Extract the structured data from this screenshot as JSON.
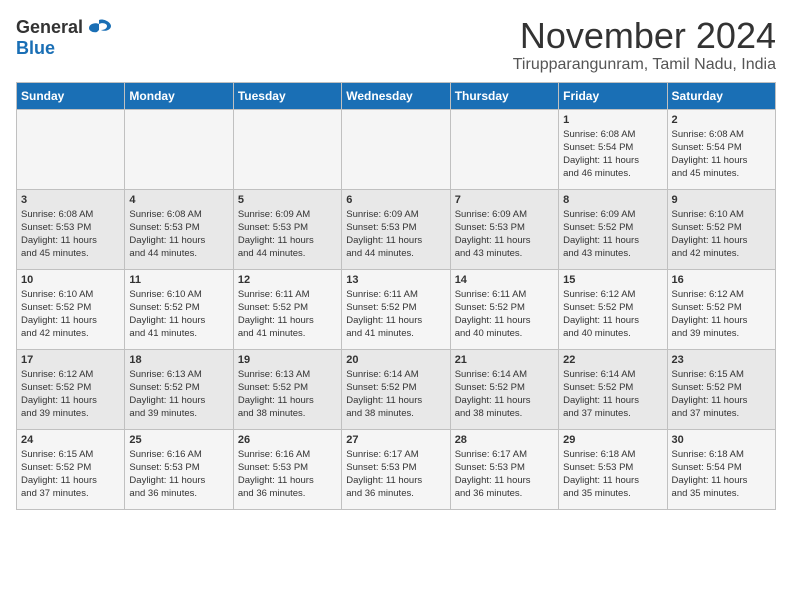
{
  "header": {
    "logo_general": "General",
    "logo_blue": "Blue",
    "title": "November 2024",
    "subtitle": "Tirupparangunram, Tamil Nadu, India"
  },
  "calendar": {
    "days_of_week": [
      "Sunday",
      "Monday",
      "Tuesday",
      "Wednesday",
      "Thursday",
      "Friday",
      "Saturday"
    ],
    "weeks": [
      [
        {
          "day": "",
          "info": ""
        },
        {
          "day": "",
          "info": ""
        },
        {
          "day": "",
          "info": ""
        },
        {
          "day": "",
          "info": ""
        },
        {
          "day": "",
          "info": ""
        },
        {
          "day": "1",
          "info": "Sunrise: 6:08 AM\nSunset: 5:54 PM\nDaylight: 11 hours\nand 46 minutes."
        },
        {
          "day": "2",
          "info": "Sunrise: 6:08 AM\nSunset: 5:54 PM\nDaylight: 11 hours\nand 45 minutes."
        }
      ],
      [
        {
          "day": "3",
          "info": "Sunrise: 6:08 AM\nSunset: 5:53 PM\nDaylight: 11 hours\nand 45 minutes."
        },
        {
          "day": "4",
          "info": "Sunrise: 6:08 AM\nSunset: 5:53 PM\nDaylight: 11 hours\nand 44 minutes."
        },
        {
          "day": "5",
          "info": "Sunrise: 6:09 AM\nSunset: 5:53 PM\nDaylight: 11 hours\nand 44 minutes."
        },
        {
          "day": "6",
          "info": "Sunrise: 6:09 AM\nSunset: 5:53 PM\nDaylight: 11 hours\nand 44 minutes."
        },
        {
          "day": "7",
          "info": "Sunrise: 6:09 AM\nSunset: 5:53 PM\nDaylight: 11 hours\nand 43 minutes."
        },
        {
          "day": "8",
          "info": "Sunrise: 6:09 AM\nSunset: 5:52 PM\nDaylight: 11 hours\nand 43 minutes."
        },
        {
          "day": "9",
          "info": "Sunrise: 6:10 AM\nSunset: 5:52 PM\nDaylight: 11 hours\nand 42 minutes."
        }
      ],
      [
        {
          "day": "10",
          "info": "Sunrise: 6:10 AM\nSunset: 5:52 PM\nDaylight: 11 hours\nand 42 minutes."
        },
        {
          "day": "11",
          "info": "Sunrise: 6:10 AM\nSunset: 5:52 PM\nDaylight: 11 hours\nand 41 minutes."
        },
        {
          "day": "12",
          "info": "Sunrise: 6:11 AM\nSunset: 5:52 PM\nDaylight: 11 hours\nand 41 minutes."
        },
        {
          "day": "13",
          "info": "Sunrise: 6:11 AM\nSunset: 5:52 PM\nDaylight: 11 hours\nand 41 minutes."
        },
        {
          "day": "14",
          "info": "Sunrise: 6:11 AM\nSunset: 5:52 PM\nDaylight: 11 hours\nand 40 minutes."
        },
        {
          "day": "15",
          "info": "Sunrise: 6:12 AM\nSunset: 5:52 PM\nDaylight: 11 hours\nand 40 minutes."
        },
        {
          "day": "16",
          "info": "Sunrise: 6:12 AM\nSunset: 5:52 PM\nDaylight: 11 hours\nand 39 minutes."
        }
      ],
      [
        {
          "day": "17",
          "info": "Sunrise: 6:12 AM\nSunset: 5:52 PM\nDaylight: 11 hours\nand 39 minutes."
        },
        {
          "day": "18",
          "info": "Sunrise: 6:13 AM\nSunset: 5:52 PM\nDaylight: 11 hours\nand 39 minutes."
        },
        {
          "day": "19",
          "info": "Sunrise: 6:13 AM\nSunset: 5:52 PM\nDaylight: 11 hours\nand 38 minutes."
        },
        {
          "day": "20",
          "info": "Sunrise: 6:14 AM\nSunset: 5:52 PM\nDaylight: 11 hours\nand 38 minutes."
        },
        {
          "day": "21",
          "info": "Sunrise: 6:14 AM\nSunset: 5:52 PM\nDaylight: 11 hours\nand 38 minutes."
        },
        {
          "day": "22",
          "info": "Sunrise: 6:14 AM\nSunset: 5:52 PM\nDaylight: 11 hours\nand 37 minutes."
        },
        {
          "day": "23",
          "info": "Sunrise: 6:15 AM\nSunset: 5:52 PM\nDaylight: 11 hours\nand 37 minutes."
        }
      ],
      [
        {
          "day": "24",
          "info": "Sunrise: 6:15 AM\nSunset: 5:52 PM\nDaylight: 11 hours\nand 37 minutes."
        },
        {
          "day": "25",
          "info": "Sunrise: 6:16 AM\nSunset: 5:53 PM\nDaylight: 11 hours\nand 36 minutes."
        },
        {
          "day": "26",
          "info": "Sunrise: 6:16 AM\nSunset: 5:53 PM\nDaylight: 11 hours\nand 36 minutes."
        },
        {
          "day": "27",
          "info": "Sunrise: 6:17 AM\nSunset: 5:53 PM\nDaylight: 11 hours\nand 36 minutes."
        },
        {
          "day": "28",
          "info": "Sunrise: 6:17 AM\nSunset: 5:53 PM\nDaylight: 11 hours\nand 36 minutes."
        },
        {
          "day": "29",
          "info": "Sunrise: 6:18 AM\nSunset: 5:53 PM\nDaylight: 11 hours\nand 35 minutes."
        },
        {
          "day": "30",
          "info": "Sunrise: 6:18 AM\nSunset: 5:54 PM\nDaylight: 11 hours\nand 35 minutes."
        }
      ]
    ]
  }
}
